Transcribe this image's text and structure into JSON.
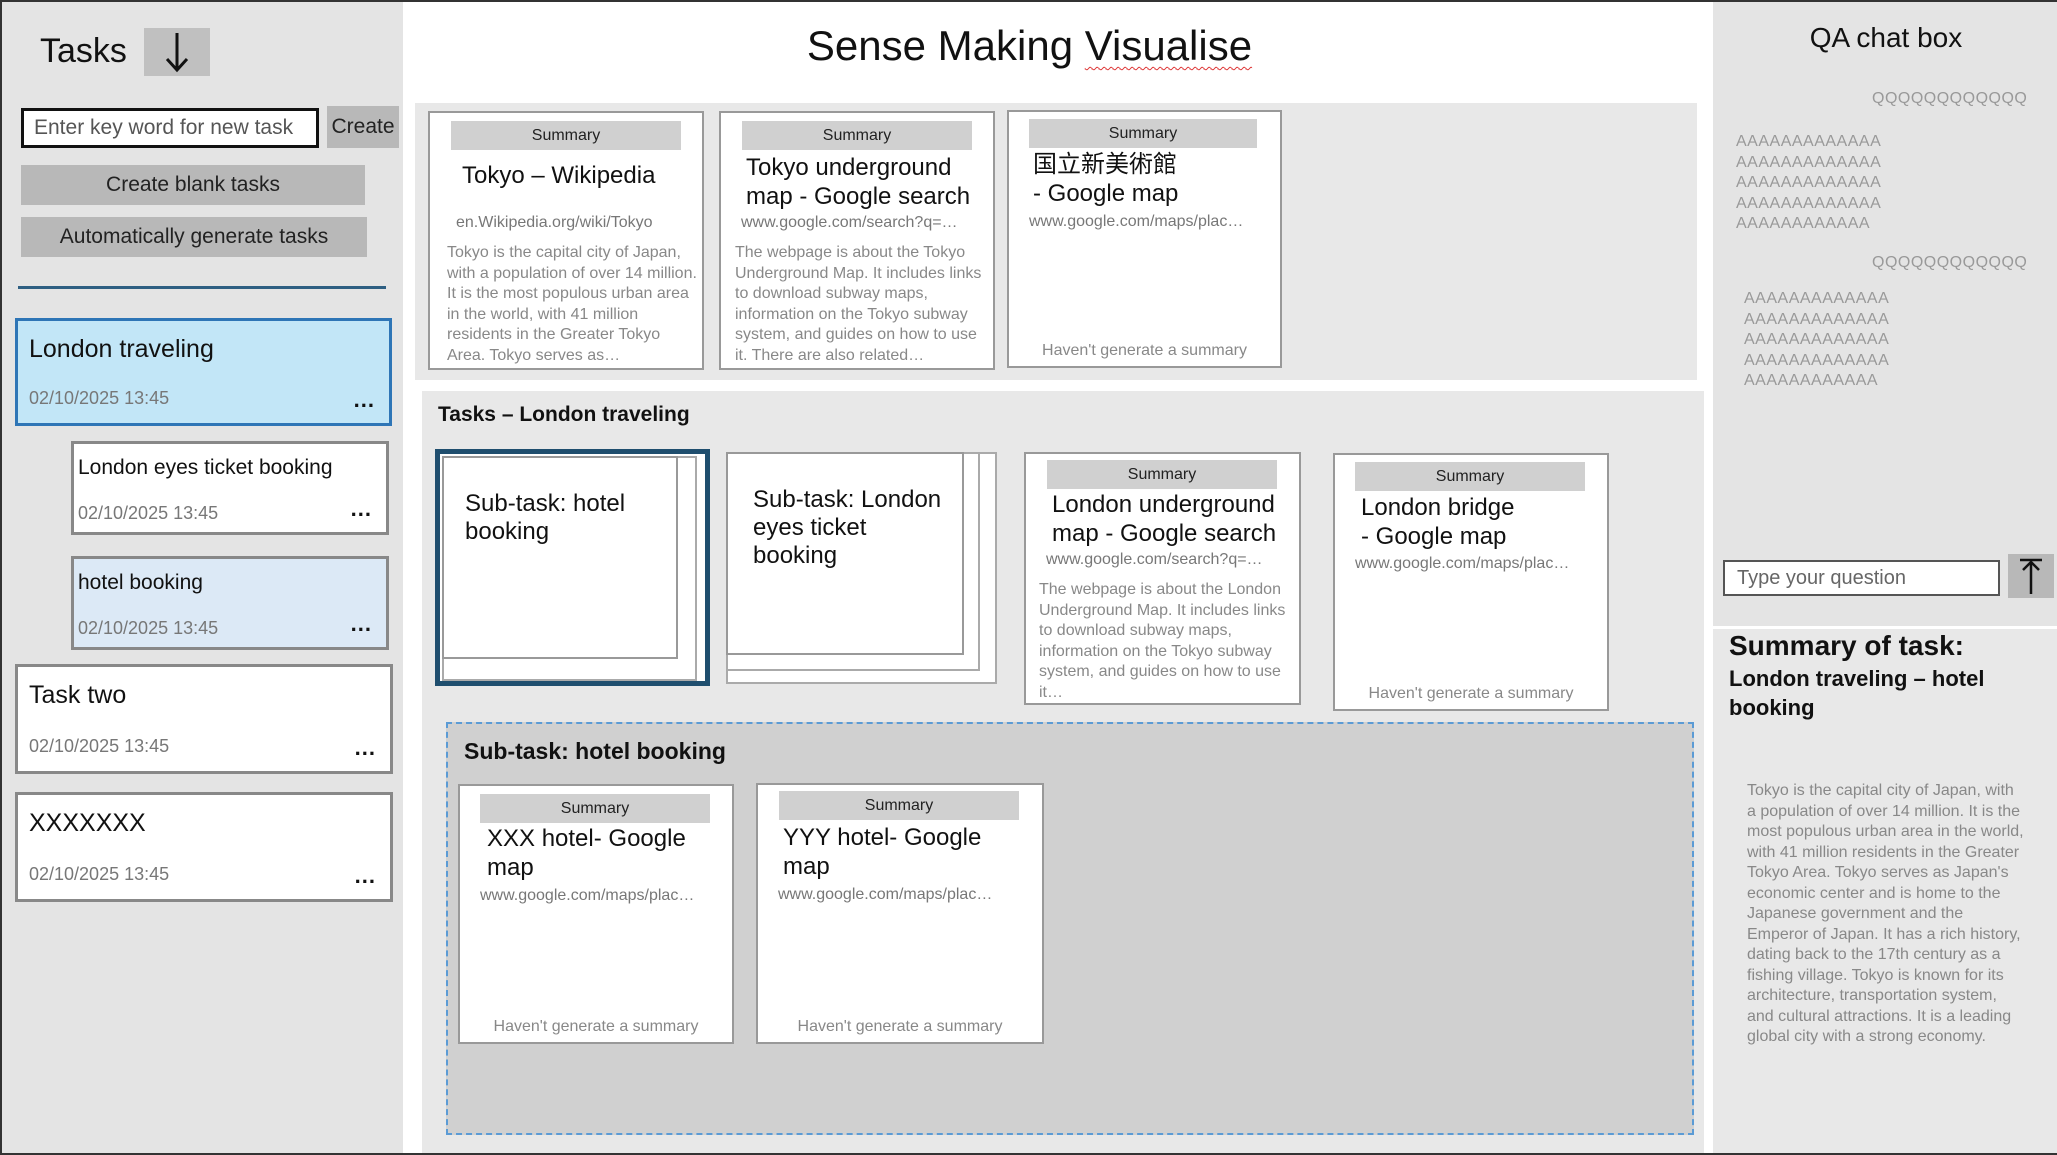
{
  "sidebar": {
    "title": "Tasks",
    "new_task_placeholder": "Enter key word for new task",
    "create_label": "Create",
    "create_blank_label": "Create blank tasks",
    "auto_generate_label": "Automatically generate tasks",
    "tasks": [
      {
        "title": "London traveling",
        "date": "02/10/2025 13:45",
        "more": "..."
      },
      {
        "title": "London eyes ticket booking",
        "date": "02/10/2025 13:45",
        "more": "..."
      },
      {
        "title": "hotel booking",
        "date": "02/10/2025 13:45",
        "more": "..."
      },
      {
        "title": "Task two",
        "date": "02/10/2025 13:45",
        "more": "..."
      },
      {
        "title": "XXXXXXX",
        "date": "02/10/2025 13:45",
        "more": "..."
      }
    ]
  },
  "main": {
    "title_a": "Sense Making ",
    "title_b": "Visualise",
    "summary_label": "Summary",
    "no_summary_text": "Haven't generate a summary",
    "top_cards": [
      {
        "title": "Tokyo – Wikipedia",
        "url": "en.Wikipedia.org/wiki/Tokyo",
        "desc": "Tokyo is the capital city of Japan, with a population of over 14 million. It is the most populous urban area in the world, with 41 million residents in the Greater Tokyo Area. Tokyo serves as…"
      },
      {
        "title": "Tokyo underground map - Google search",
        "url": "www.google.com/search?q=…",
        "desc": "The webpage is about the Tokyo Underground Map. It includes links to download subway maps, information on the Tokyo subway system, and guides on how to use it. There are also related…"
      },
      {
        "title": "国立新美術館\n- Google map",
        "url": "www.google.com/maps/plac…"
      }
    ],
    "task_section": {
      "label": "Tasks – London traveling",
      "subtask_cards": [
        "Sub-task: hotel booking",
        "Sub-task: London eyes ticket booking"
      ],
      "cards": [
        {
          "title": "London underground map - Google search",
          "url": "www.google.com/search?q=…",
          "desc": "The webpage is about the London Underground Map. It includes links to download subway maps, information on the Tokyo subway system, and guides on how to use it…"
        },
        {
          "title": "London bridge\n- Google map",
          "url": "www.google.com/maps/plac…"
        }
      ]
    },
    "subtask_section": {
      "label": "Sub-task: hotel booking",
      "cards": [
        {
          "title": "XXX hotel- Google map",
          "url": "www.google.com/maps/plac…"
        },
        {
          "title": "YYY hotel- Google map",
          "url": "www.google.com/maps/plac…"
        }
      ]
    }
  },
  "qa": {
    "title": "QA chat box",
    "question_1": "QQQQQQQQQQQQ",
    "answer_1": [
      "AAAAAAAAAAAAA",
      "AAAAAAAAAAAAA",
      "AAAAAAAAAAAAA",
      "AAAAAAAAAAAAA",
      "AAAAAAAAAAAA"
    ],
    "question_2": "QQQQQQQQQQQQ",
    "answer_2": [
      "AAAAAAAAAAAAA",
      "AAAAAAAAAAAAA",
      "AAAAAAAAAAAAA",
      "AAAAAAAAAAAAA",
      "AAAAAAAAAAAA"
    ],
    "input_placeholder": "Type your question",
    "summary_heading": "Summary of task:",
    "summary_task": "London traveling – hotel booking",
    "summary_text": "Tokyo is the capital city of Japan, with a population of over 14 million. It is the most populous urban area in the world, with 41 million residents in the Greater Tokyo Area. Tokyo serves as Japan's economic center and is home to the Japanese government and the Emperor of Japan. It has a rich history, dating back to the 17th century as a fishing village. Tokyo is known for its architecture, transportation system, and cultural attractions. It is a leading global city with a strong economy."
  },
  "colors": {
    "selected_bg": "#c2e6f7",
    "selected_border": "#2e75b6",
    "subtask_selected_bg": "#dce9f6",
    "card_selected_border": "#1f4e6e",
    "divider": "#2e5f82"
  }
}
